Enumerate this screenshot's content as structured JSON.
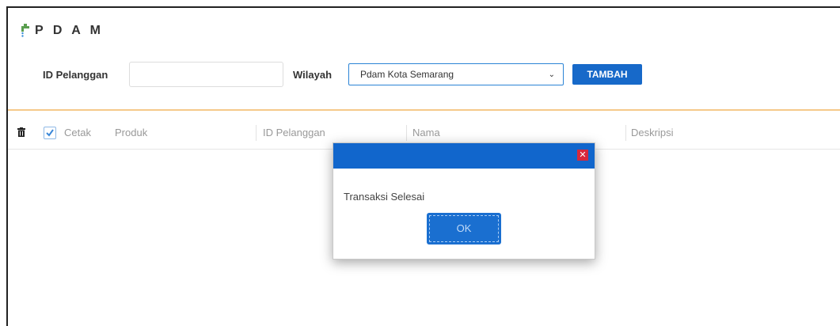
{
  "app": {
    "title": "PDAM",
    "title_display": "P D A M"
  },
  "form": {
    "id_label": "ID Pelanggan",
    "id_value": "",
    "wilayah_label": "Wilayah",
    "wilayah_selected": "Pdam Kota Semarang",
    "add_button": "TAMBAH"
  },
  "table": {
    "columns": [
      "Cetak",
      "Produk",
      "ID Pelanggan",
      "Nama",
      "Deskripsi"
    ],
    "print_checked": true
  },
  "dialog": {
    "message": "Transaksi Selesai",
    "ok_label": "OK",
    "close_icon": "close-icon"
  },
  "colors": {
    "primary": "#1166cc",
    "button": "#1769c9",
    "close": "#d8283c",
    "divider": "#f5c98a"
  }
}
